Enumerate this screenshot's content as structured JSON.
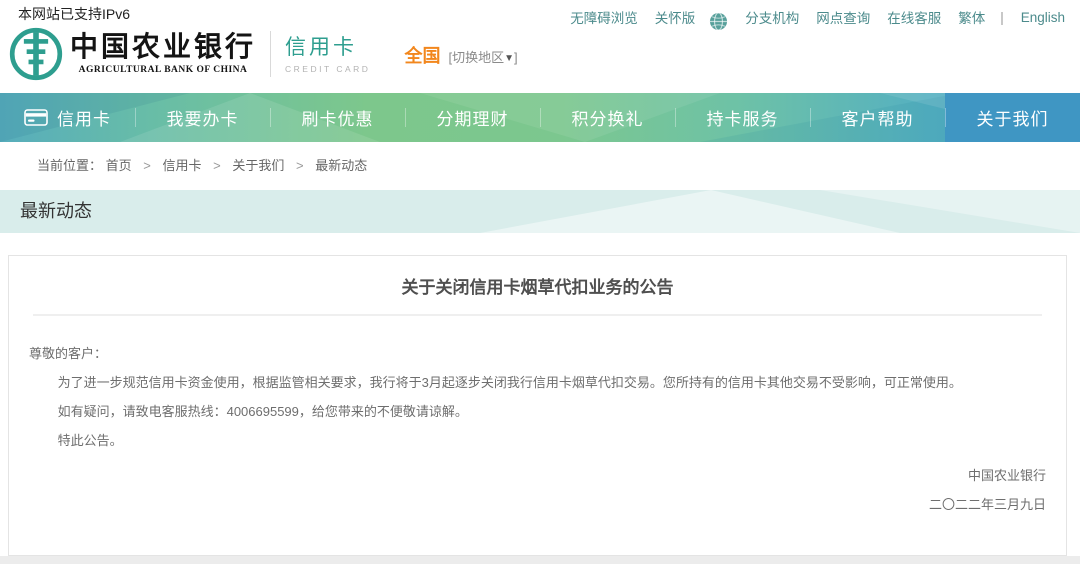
{
  "colors": {
    "brand_teal": "#2e9e8f",
    "accent_orange": "#f2871d",
    "nav_active_blue": "#3f96c3",
    "band_mint": "#d9edeb"
  },
  "topbar": {
    "ipv6_notice": "本网站已支持IPv6",
    "utility_links": [
      {
        "label": "无障碍浏览"
      },
      {
        "label": "关怀版"
      },
      {
        "label": "分支机构"
      },
      {
        "label": "网点查询"
      },
      {
        "label": "在线客服"
      },
      {
        "label": "繁体"
      },
      {
        "label": "English"
      }
    ]
  },
  "brand": {
    "bank_name_cn": "中国农业银行",
    "bank_name_en": "AGRICULTURAL BANK OF CHINA",
    "section_cn": "信用卡",
    "section_en": "CREDIT CARD",
    "region": "全国",
    "region_switch_open": "[",
    "region_switch_label": "切换地区",
    "region_switch_close": "]"
  },
  "nav": {
    "items": [
      {
        "label": "信用卡"
      },
      {
        "label": "我要办卡"
      },
      {
        "label": "刷卡优惠"
      },
      {
        "label": "分期理财"
      },
      {
        "label": "积分换礼"
      },
      {
        "label": "持卡服务"
      },
      {
        "label": "客户帮助"
      },
      {
        "label": "关于我们"
      }
    ]
  },
  "breadcrumb": {
    "label": "当前位置：",
    "separator": ">",
    "segments": [
      "首页",
      "信用卡",
      "关于我们",
      "最新动态"
    ]
  },
  "page": {
    "section_title": "最新动态"
  },
  "article": {
    "title": "关于关闭信用卡烟草代扣业务的公告",
    "salutation": "尊敬的客户：",
    "paragraphs": [
      "为了进一步规范信用卡资金使用，根据监管相关要求，我行将于3月起逐步关闭我行信用卡烟草代扣交易。您所持有的信用卡其他交易不受影响，可正常使用。",
      "如有疑问，请致电客服热线：4006695599，给您带来的不便敬请谅解。",
      "特此公告。"
    ],
    "signature": "中国农业银行",
    "date": "二〇二二年三月九日"
  }
}
